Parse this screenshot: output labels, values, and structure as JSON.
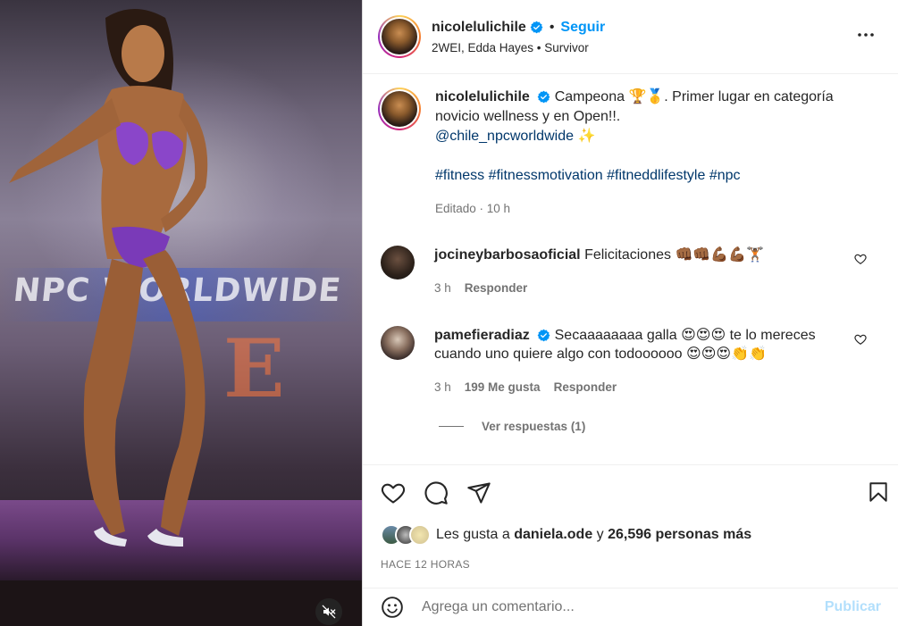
{
  "post": {
    "username": "nicolelulichile",
    "follow_label": "Seguir",
    "dot": "•",
    "audio": "2WEI, Edda Hayes • Survivor",
    "media_banner_text": "NPC WORLDWIDE"
  },
  "caption": {
    "username": "nicolelulichile",
    "text_line1": "Campeona 🏆🥇. Primer lugar en categoría novicio wellness y en Open!!.",
    "mention": "@chile_npcworldwide",
    "sparkle": "✨",
    "hashtags": "#fitness #fitnessmotivation #fitneddlifestyle #npc",
    "meta": "Editado · 10 h"
  },
  "comments": [
    {
      "username": "jocineybarbosaoficial",
      "text": "Felicitaciones 👊🏾👊🏾💪🏾💪🏾🏋🏾",
      "time": "3 h",
      "likes": "",
      "reply_label": "Responder"
    },
    {
      "username": "pamefieradiaz",
      "text": "Secaaaaaaaa galla 😍😍😍 te lo mereces cuando uno quiere algo con todoooooo 😍😍😍👏👏",
      "time": "3 h",
      "likes": "199 Me gusta",
      "reply_label": "Responder"
    }
  ],
  "view_replies": "Ver respuestas (1)",
  "likes": {
    "prefix": "Les gusta a",
    "user": "daniela.ode",
    "connector": "y",
    "others": "26,596 personas más"
  },
  "timestamp": "HACE 12 HORAS",
  "add_comment": {
    "placeholder": "Agrega un comentario...",
    "publish_label": "Publicar"
  },
  "colors": {
    "accent": "#0095f6",
    "link": "#00376b",
    "muted": "#737373",
    "publish_disabled": "#b2dffc"
  }
}
